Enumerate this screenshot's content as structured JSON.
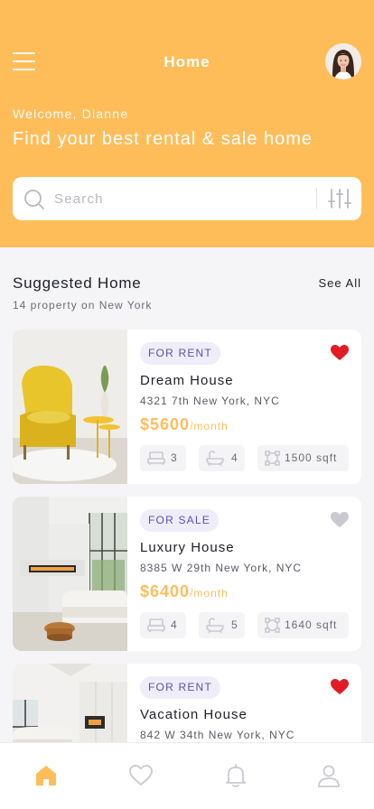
{
  "header": {
    "title": "Home",
    "welcome": "Welcome, Dianne",
    "headline": "Find your best rental & sale home"
  },
  "search": {
    "placeholder": "Search"
  },
  "section": {
    "title": "Suggested Home",
    "subtitle": "14 property on New York",
    "see_all": "See All"
  },
  "listings": [
    {
      "badge": "FOR RENT",
      "name": "Dream House",
      "address": "4321 7th New York, NYC",
      "price": "$5600",
      "period": "/month",
      "beds": "3",
      "baths": "4",
      "area": "1500 sqft",
      "favorite": true
    },
    {
      "badge": "FOR SALE",
      "name": "Luxury House",
      "address": "8385 W 29th New York, NYC",
      "price": "$6400",
      "period": "/month",
      "beds": "4",
      "baths": "5",
      "area": "1640 sqft",
      "favorite": false
    },
    {
      "badge": "FOR RENT",
      "name": "Vacation House",
      "address": "842 W 34th New York, NYC",
      "favorite": true
    }
  ],
  "tabs": [
    "home-icon",
    "heart-icon",
    "bell-icon",
    "user-icon"
  ],
  "colors": {
    "accent": "#ffbd5a",
    "badge_text": "#5b4fb2",
    "badge_bg": "#efedf9",
    "favorite": "#e31b23",
    "inactive": "#c9c9d1"
  }
}
